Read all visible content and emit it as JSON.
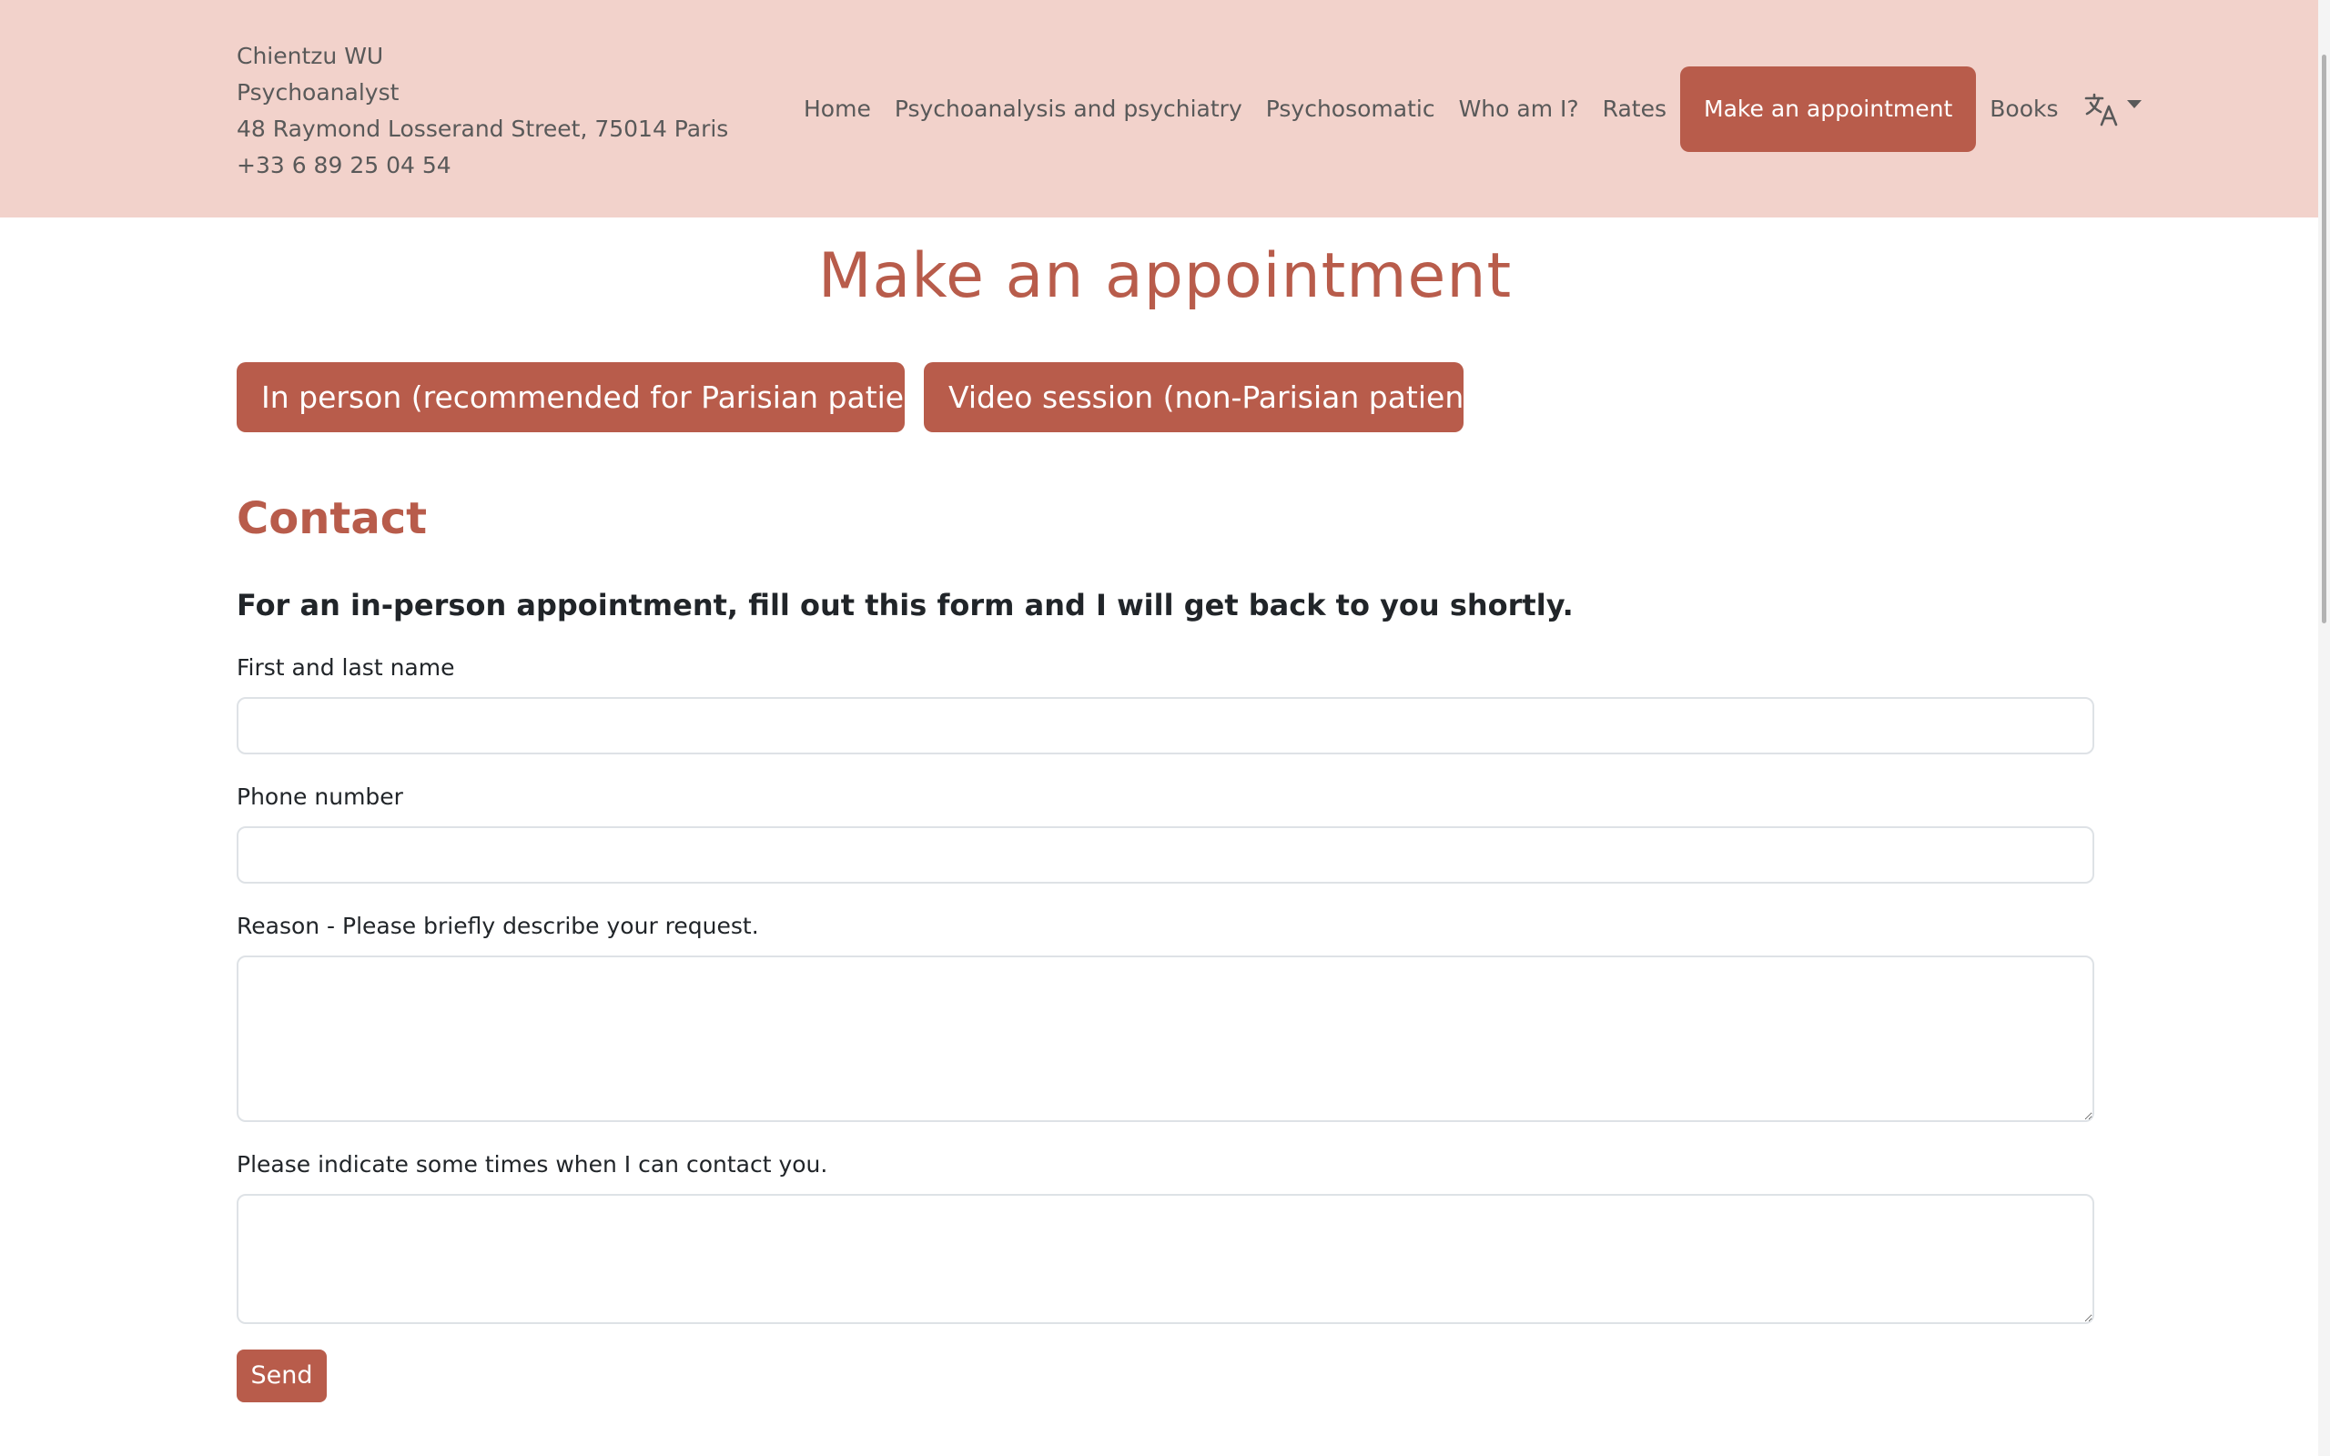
{
  "header": {
    "name": "Chientzu WU",
    "profession": "Psychoanalyst",
    "address": "48 Raymond Losserand Street, 75014 Paris",
    "phone": "+33 6 89 25 04 54"
  },
  "nav": {
    "home": "Home",
    "psychoanalysis": "Psychoanalysis and psychiatry",
    "psychosomatic": "Psychosomatic",
    "who": "Who am I?",
    "rates": "Rates",
    "appointment": "Make an appointment",
    "books": "Books",
    "language_icon": "translate-icon"
  },
  "main": {
    "title": "Make an appointment",
    "in_person_button": "In person (recommended for Parisian patients)",
    "video_button": "Video session (non-Parisian patients)",
    "section_title": "Contact",
    "intro": "For an in-person appointment, fill out this form and I will get back to you shortly."
  },
  "form": {
    "name_label": "First and last name",
    "name_value": "",
    "phone_label": "Phone number",
    "phone_value": "",
    "reason_label": "Reason - Please briefly describe your request.",
    "reason_value": "",
    "times_label": "Please indicate some times when I can contact you.",
    "times_value": "",
    "send_label": "Send"
  },
  "colors": {
    "accent": "#b85c4b",
    "header_bg": "#f2d2cb",
    "nav_text": "#595959"
  }
}
